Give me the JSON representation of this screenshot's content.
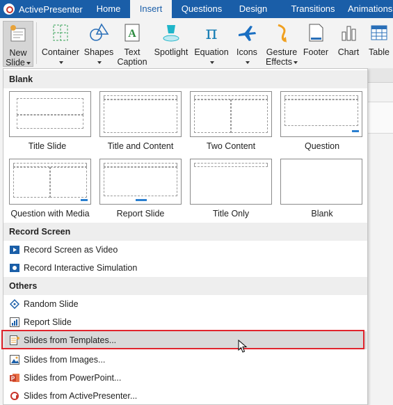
{
  "app": {
    "name": "ActivePresenter"
  },
  "tabs": [
    {
      "label": "Home"
    },
    {
      "label": "Insert"
    },
    {
      "label": "Questions"
    },
    {
      "label": "Design"
    },
    {
      "label": "Transitions"
    },
    {
      "label": "Animations"
    }
  ],
  "ribbon": {
    "new_slide": {
      "line1": "New",
      "line2": "Slide"
    },
    "container": "Container",
    "shapes": "Shapes",
    "text_caption": {
      "line1": "Text",
      "line2": "Caption"
    },
    "spotlight": "Spotlight",
    "equation": "Equation",
    "icons": "Icons",
    "gesture_effects": {
      "line1": "Gesture",
      "line2": "Effects"
    },
    "footer": "Footer",
    "chart": "Chart",
    "table": "Table"
  },
  "menu": {
    "blank_section": "Blank",
    "layouts": [
      {
        "label": "Title Slide"
      },
      {
        "label": "Title and Content"
      },
      {
        "label": "Two Content"
      },
      {
        "label": "Question"
      },
      {
        "label": "Question with Media"
      },
      {
        "label": "Report Slide"
      },
      {
        "label": "Title Only"
      },
      {
        "label": "Blank"
      }
    ],
    "record_section": "Record Screen",
    "record_items": [
      {
        "label": "Record Screen as Video",
        "icon": "video-camera-icon"
      },
      {
        "label": "Record Interactive Simulation",
        "icon": "camera-icon"
      }
    ],
    "others_section": "Others",
    "other_items": [
      {
        "label": "Random Slide",
        "icon": "random-slide-icon"
      },
      {
        "label": "Report Slide",
        "icon": "report-slide-icon"
      },
      {
        "label": "Slides from Templates...",
        "icon": "template-icon"
      },
      {
        "label": "Slides from Images...",
        "icon": "image-icon"
      },
      {
        "label": "Slides from PowerPoint...",
        "icon": "powerpoint-icon"
      },
      {
        "label": "Slides from ActivePresenter...",
        "icon": "activepresenter-icon"
      }
    ]
  },
  "colors": {
    "tab_bar": "#1a5ea8",
    "accent_blue": "#2a7fd0",
    "highlight_border": "#e0242c"
  }
}
